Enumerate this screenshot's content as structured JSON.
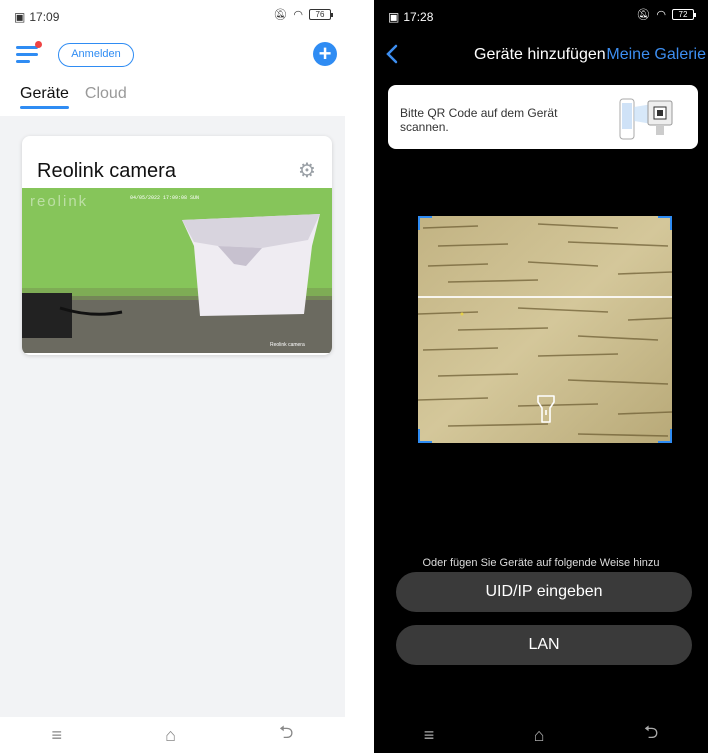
{
  "left_screen": {
    "status": {
      "time": "17:09",
      "battery": "76"
    },
    "header": {
      "login_label": "Anmelden",
      "add_icon": "plus-circle-icon"
    },
    "tabs": [
      {
        "label": "Geräte",
        "active": true
      },
      {
        "label": "Cloud",
        "active": false
      }
    ],
    "camera_card": {
      "title": "Reolink camera",
      "preview_overlay_brand": "reolink",
      "preview_timestamp": "04/05/2022 17:09:08 SUN",
      "preview_caption": "Reolink camera"
    }
  },
  "right_screen": {
    "status": {
      "time": "17:28",
      "battery": "72"
    },
    "header": {
      "title": "Geräte hinzufügen",
      "gallery_label": "Meine Galerie"
    },
    "qr_hint": {
      "text": "Bitte QR Code auf dem Gerät scannen."
    },
    "alternative_text": "Oder fügen Sie Geräte auf folgende Weise hinzu",
    "buttons": {
      "uid_ip": "UID/IP eingeben",
      "lan": "LAN"
    }
  },
  "colors": {
    "accent": "#2f8cf3",
    "notification": "#ef4444",
    "gallery_link": "#3d8ef0"
  },
  "icons": [
    "menu-icon",
    "gear-icon",
    "plus-circle-icon",
    "back-chevron-icon",
    "flashlight-icon",
    "home-icon",
    "menu-lines-icon",
    "back-nav-icon"
  ]
}
